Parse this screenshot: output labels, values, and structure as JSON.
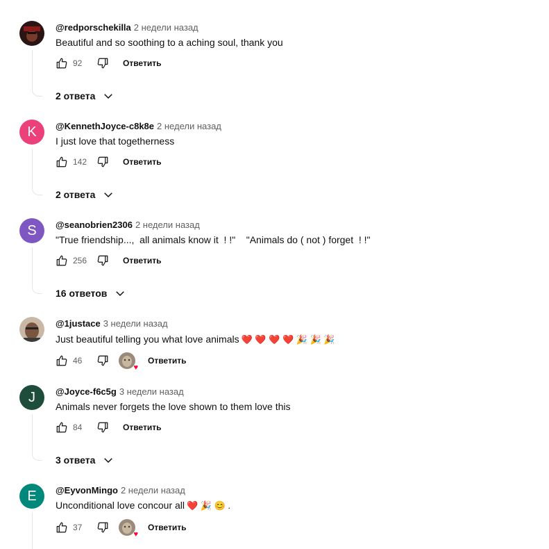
{
  "action_labels": {
    "reply": "Ответить"
  },
  "comments": [
    {
      "author": "@redporschekilla",
      "time": "2 недели назад",
      "text": "Beautiful and so soothing to a aching soul, thank you",
      "likes": "92",
      "replies_label": "2 ответа",
      "avatar_letter": "",
      "avatar_color": "#3a2020"
    },
    {
      "author": "@KennethJoyce-c8k8e",
      "time": "2 недели назад",
      "text": "I just love that togetherness",
      "likes": "142",
      "replies_label": "2 ответа",
      "avatar_letter": "K",
      "avatar_color": "#ec407a"
    },
    {
      "author": "@seanobrien2306",
      "time": "2 недели назад",
      "text": "\"True friendship...,  all animals know it  ! !\"    \"Animals do ( not ) forget  ! !\"",
      "likes": "256",
      "replies_label": "16 ответов",
      "avatar_letter": "S",
      "avatar_color": "#7e57c2"
    },
    {
      "author": "@1justace",
      "time": "3 недели назад",
      "text": "Just beautiful telling you what love animals",
      "emoji": "❤️ ❤️ ❤️ ❤️ 🎉 🎉 🎉",
      "likes": "46",
      "avatar_letter": "",
      "avatar_color": "#a08a78"
    },
    {
      "author": "@Joyce-f6c5g",
      "time": "3 недели назад",
      "text": "Animals never forgets the love shown to them love this",
      "likes": "84",
      "replies_label": "3 ответа",
      "avatar_letter": "J",
      "avatar_color": "#1e4d3b"
    },
    {
      "author": "@EyvonMingo",
      "time": "2 недели назад",
      "text": "Unconditional love concour all",
      "emoji": "❤️ 🎉 😊 .",
      "likes": "37",
      "avatar_letter": "E",
      "avatar_color": "#00897b"
    }
  ]
}
